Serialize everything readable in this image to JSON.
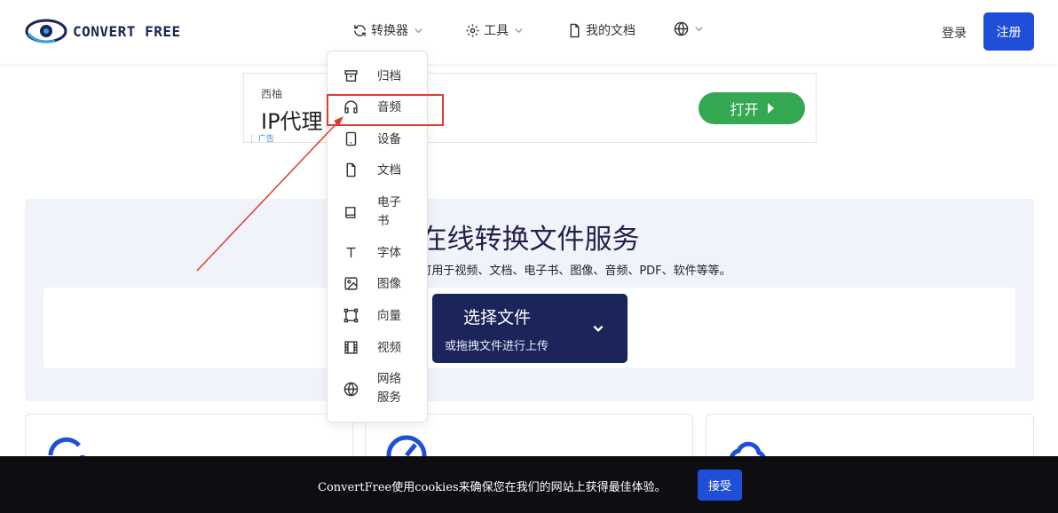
{
  "header": {
    "logo_text": "CONVERT FREE",
    "nav": {
      "converter": "转换器",
      "tools": "工具",
      "my_docs": "我的文档"
    },
    "login": "登录",
    "register": "注册"
  },
  "ad": {
    "brand": "西柚",
    "title": "IP代理",
    "label": "广告",
    "button": "打开"
  },
  "hero": {
    "title": "在线转换文件服务",
    "subtitle": "让用户找到…器，可用于视频、文档、电子书、图像、音频、PDF、软件等等。",
    "choose_title": "选择文件",
    "choose_sub": "或拖拽文件进行上传"
  },
  "dropdown": {
    "items": [
      {
        "label": "归档",
        "icon": "archive-icon"
      },
      {
        "label": "音频",
        "icon": "headphones-icon"
      },
      {
        "label": "设备",
        "icon": "tablet-icon"
      },
      {
        "label": "文档",
        "icon": "document-icon"
      },
      {
        "label": "电子书",
        "icon": "book-icon"
      },
      {
        "label": "字体",
        "icon": "font-icon"
      },
      {
        "label": "图像",
        "icon": "image-icon"
      },
      {
        "label": "向量",
        "icon": "vector-icon"
      },
      {
        "label": "视频",
        "icon": "film-icon"
      },
      {
        "label": "网络服务",
        "icon": "globe-icon"
      }
    ],
    "highlighted": "音频"
  },
  "cookie": {
    "text": "ConvertFree使用cookies来确保您在我们的网站上获得最佳体验。",
    "accept": "接受"
  },
  "colors": {
    "primary": "#1f4fd8",
    "navy": "#1b2559",
    "ad_green": "#34a853",
    "highlight_red": "#e03b2f",
    "hero_bg": "#f1f3fb"
  }
}
